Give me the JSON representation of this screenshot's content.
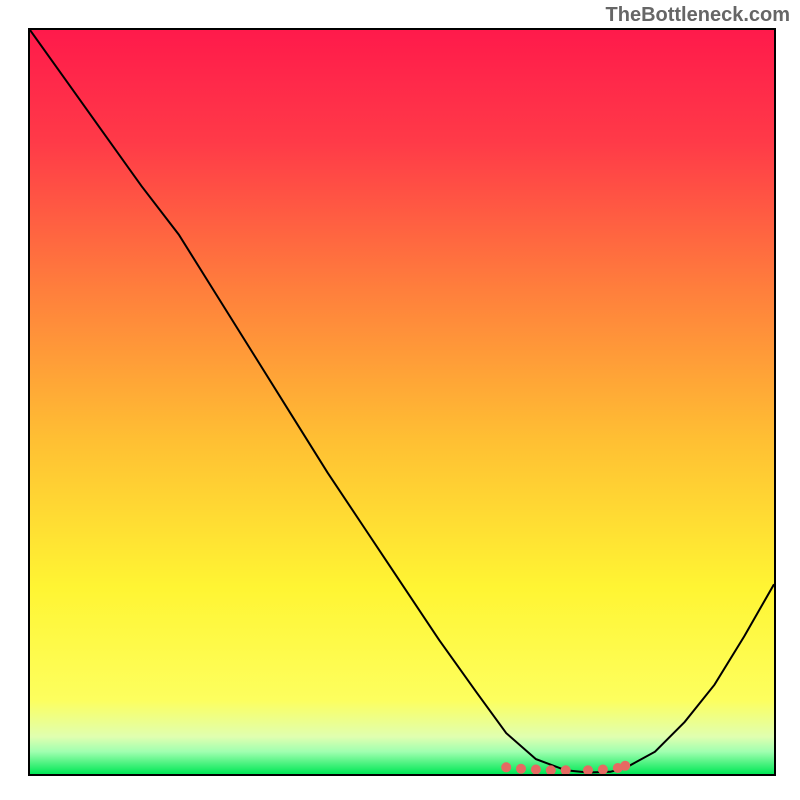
{
  "watermark": "TheBottleneck.com",
  "chart_data": {
    "type": "line",
    "title": "",
    "xlabel": "",
    "ylabel": "",
    "xlim": [
      0,
      100
    ],
    "ylim": [
      0,
      100
    ],
    "grid": false,
    "gradient_colors": {
      "top": "#ff1a4b",
      "mid": "#ffbf33",
      "lower": "#fdff5e",
      "bottom": "#00e756"
    },
    "series": [
      {
        "name": "bottleneck-curve",
        "type": "line",
        "color": "#000000",
        "x": [
          0.0,
          5.0,
          10.0,
          15.0,
          20.0,
          25.0,
          30.0,
          35.0,
          40.0,
          45.0,
          50.0,
          55.0,
          60.0,
          64.0,
          68.0,
          72.0,
          75.0,
          78.0,
          80.0,
          84.0,
          88.0,
          92.0,
          96.0,
          100.0
        ],
        "y": [
          100.0,
          93.0,
          86.0,
          79.0,
          72.5,
          64.5,
          56.5,
          48.5,
          40.5,
          33.0,
          25.5,
          18.0,
          11.0,
          5.5,
          2.0,
          0.5,
          0.2,
          0.3,
          0.8,
          3.0,
          7.0,
          12.0,
          18.5,
          25.5
        ]
      },
      {
        "name": "optimal-points",
        "type": "scatter",
        "color": "#e66a62",
        "x": [
          64.0,
          66.0,
          68.0,
          70.0,
          72.0,
          75.0,
          77.0,
          79.0,
          80.0
        ],
        "y": [
          0.9,
          0.7,
          0.6,
          0.5,
          0.5,
          0.5,
          0.6,
          0.8,
          1.1
        ]
      }
    ]
  }
}
